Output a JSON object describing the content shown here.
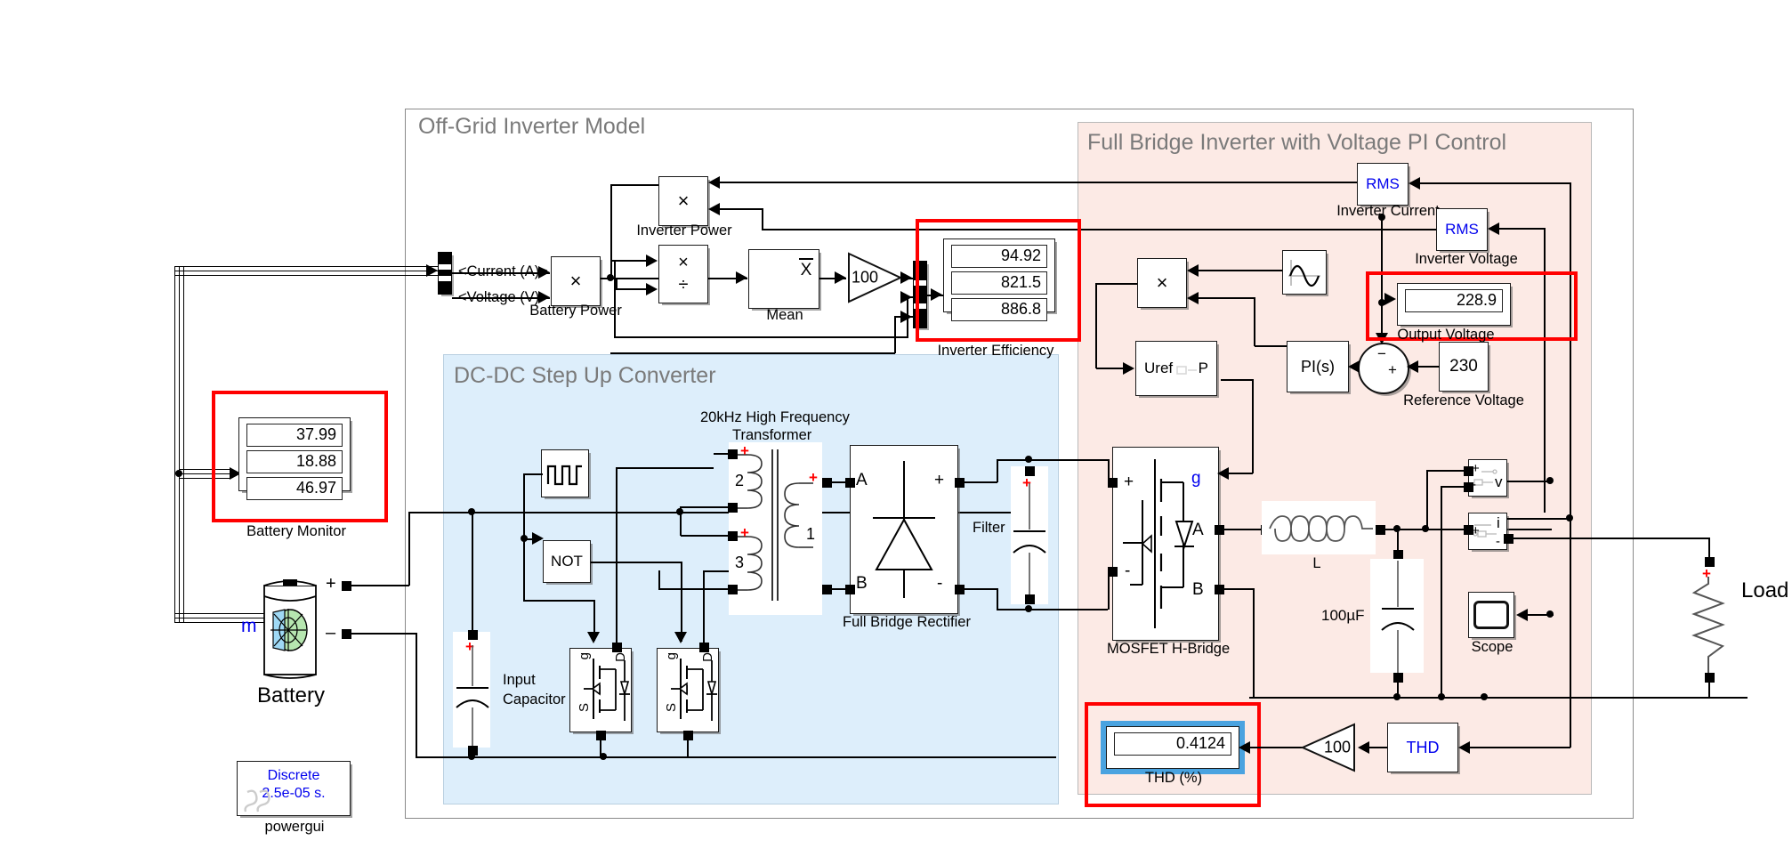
{
  "diagram": {
    "title": "Off-Grid Inverter Model",
    "subsystems": [
      {
        "name": "Off-Grid Inverter Model",
        "color": "#ffffff"
      },
      {
        "name": "DC-DC Step Up Converter",
        "color": "#ddeefb"
      },
      {
        "name": "Full Bridge Inverter with Voltage PI Control",
        "color": "#fceae5"
      }
    ]
  },
  "labels": {
    "off_grid_title": "Off-Grid Inverter Model",
    "dcdc_title": "DC-DC Step Up Converter",
    "fullbridge_title": "Full Bridge Inverter with Voltage PI Control",
    "battery": "Battery",
    "battery_m_port": "m",
    "battery_plus": "+",
    "battery_minus": "–",
    "powergui": "powergui",
    "powergui_line1": "Discrete",
    "powergui_line2": "2.5e-05 s.",
    "battery_monitor": "Battery Monitor",
    "bus_current": "<Current (A)>",
    "bus_voltage": "<Voltage (V)>",
    "battery_power": "Battery Power",
    "inverter_power": "Inverter Power",
    "mean": "Mean",
    "gain_100_a": "100",
    "inverter_efficiency": "Inverter Efficiency",
    "transformer": "20kHz High Frequency\nTransformer",
    "transformer_line1": "20kHz High Frequency",
    "transformer_line2": "Transformer",
    "not_gate": "NOT",
    "input_capacitor_line1": "Input",
    "input_capacitor_line2": "Capacitor",
    "winding_2": "2",
    "winding_3": "3",
    "winding_1": "1",
    "rect_a": "A",
    "rect_b": "B",
    "rect_plus": "+",
    "rect_minus": "-",
    "full_bridge_rectifier": "Full Bridge Rectifier",
    "filter": "Filter",
    "mosfet_hbridge": "MOSFET H-Bridge",
    "hb_plus": "+",
    "hb_minus": "-",
    "hb_g": "g",
    "hb_a": "A",
    "hb_b": "B",
    "mos_g": "g",
    "mos_d": "D",
    "mos_s": "S",
    "inductor": "L",
    "capacitor_100uf": "100µF",
    "scope": "Scope",
    "load": "Load",
    "rms_current": "RMS",
    "rms_voltage": "RMS",
    "inverter_current": "Inverter Current",
    "inverter_voltage": "Inverter Voltage",
    "output_voltage": "Output Voltage",
    "reference_voltage": "Reference Voltage",
    "pi_controller": "PI(s)",
    "uref_block": "Uref       P",
    "sum_minus": "−",
    "sum_plus": "+",
    "thd_block": "THD",
    "gain_100_b": "100",
    "thd_display_label": "THD (%)",
    "vm_v": "v",
    "vm_plus": "+",
    "vm_minus": "-",
    "im_i": "i",
    "im_plus": "+",
    "im_minus": "-",
    "product_x": "×",
    "divide_x": "×",
    "divide_div": "÷",
    "mean_x": "X"
  },
  "values": {
    "battery_monitor": [
      "37.99",
      "18.88",
      "46.97"
    ],
    "inverter_efficiency": [
      "94.92",
      "821.5",
      "886.8"
    ],
    "output_voltage": "228.9",
    "reference_voltage": "230",
    "thd_percent": "0.4124",
    "gain_efficiency": "100",
    "gain_thd": "100",
    "sample_time": "2.5e-05 s.",
    "solver": "Discrete"
  },
  "colors": {
    "dcdc_fill": "#ddeefb",
    "fullbridge_fill": "#fceae5",
    "highlight": "#ff0000",
    "selection": "#4aa3e0",
    "blue_text": "#0000ee",
    "frame_title": "#7a7a7a",
    "port_plus": "#ff0000"
  }
}
